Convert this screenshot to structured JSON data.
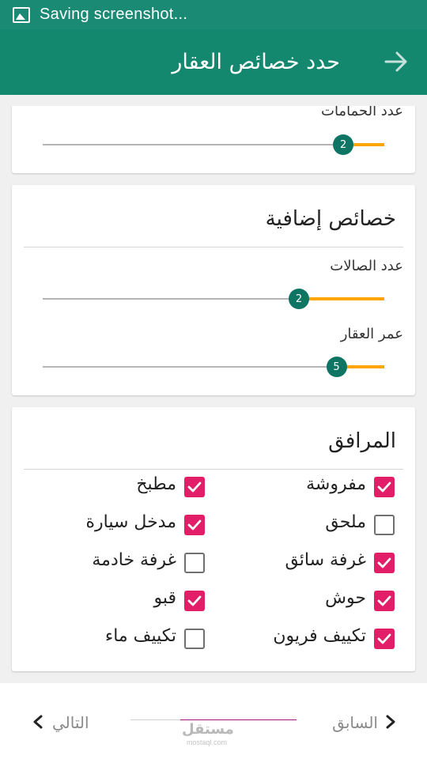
{
  "statusbar": {
    "text": "Saving screenshot..."
  },
  "appbar": {
    "title": "حدد خصائص العقار",
    "back_icon": "arrow-right-icon"
  },
  "card1": {
    "slider_label": "عدد الحمامات",
    "value": "2",
    "fraction": 0.88
  },
  "card2": {
    "title": "خصائص إضافية",
    "sliders": [
      {
        "label": "عدد الصالات",
        "value": "2",
        "fraction": 0.75
      },
      {
        "label": "عمر العقار",
        "value": "5",
        "fraction": 0.86
      }
    ]
  },
  "amenities": {
    "title": "المرافق",
    "right_column": [
      {
        "label": "مفروشة",
        "checked": true
      },
      {
        "label": "ملحق",
        "checked": false
      },
      {
        "label": "غرفة سائق",
        "checked": true
      },
      {
        "label": "حوش",
        "checked": true
      },
      {
        "label": "تكييف فريون",
        "checked": true
      }
    ],
    "left_column": [
      {
        "label": "مطبخ",
        "checked": true
      },
      {
        "label": "مدخل سيارة",
        "checked": true
      },
      {
        "label": "غرفة خادمة",
        "checked": false
      },
      {
        "label": "قبو",
        "checked": true
      },
      {
        "label": "تكييف ماء",
        "checked": false
      }
    ]
  },
  "bottom": {
    "prev_label": "السابق",
    "next_label": "التالي",
    "progress": 0.7,
    "watermark": "مستقل",
    "watermark_sub": "mostaql.com"
  },
  "colors": {
    "primary": "#14876f",
    "accent": "#ffa500",
    "checkbox": "#e31d68",
    "thumb": "#0e7565"
  }
}
